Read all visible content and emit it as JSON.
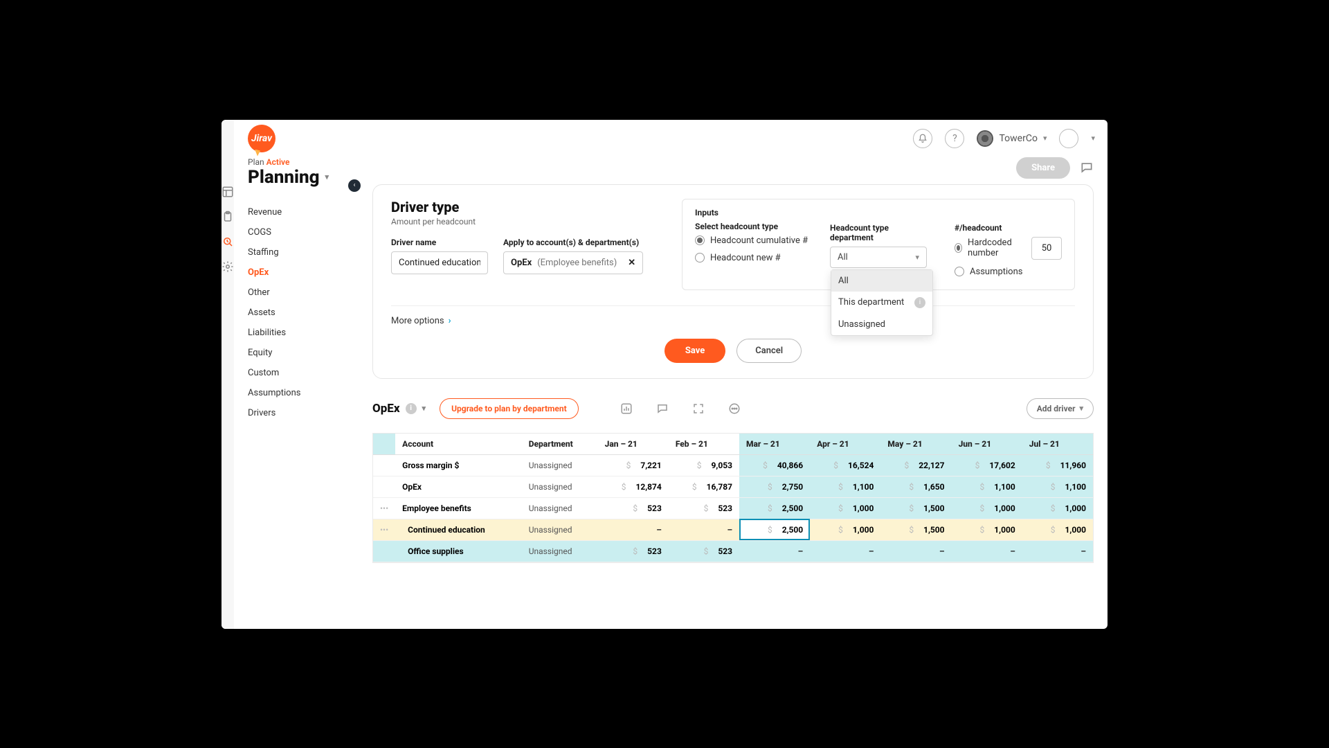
{
  "brand": {
    "name": "Jirav"
  },
  "top": {
    "org": "TowerCo",
    "share": "Share"
  },
  "plan": {
    "label": "Plan",
    "status": "Active",
    "title": "Planning"
  },
  "nav": [
    "Revenue",
    "COGS",
    "Staffing",
    "OpEx",
    "Other",
    "Assets",
    "Liabilities",
    "Equity",
    "Custom",
    "Assumptions",
    "Drivers"
  ],
  "nav_active": "OpEx",
  "driver": {
    "section_title": "Driver type",
    "section_sub": "Amount per headcount",
    "name_label": "Driver name",
    "name_value": "Continued education",
    "apply_label": "Apply to account(s) & department(s)",
    "apply_account": "OpEx",
    "apply_detail": "(Employee benefits)",
    "more_options": "More options",
    "save": "Save",
    "cancel": "Cancel"
  },
  "inputs": {
    "title": "Inputs",
    "headcount_type_label": "Select headcount type",
    "headcount_options": [
      "Headcount cumulative #",
      "Headcount new #"
    ],
    "headcount_selected": 0,
    "dept_label": "Headcount type department",
    "dept_value": "All",
    "dept_options": [
      "All",
      "This department",
      "Unassigned"
    ],
    "per_label": "#/headcount",
    "per_options": [
      "Hardcoded number",
      "Assumptions"
    ],
    "per_selected": 0,
    "per_value": "50"
  },
  "table_toolbar": {
    "title": "OpEx",
    "upgrade": "Upgrade to plan by department",
    "add_driver": "Add driver"
  },
  "table": {
    "columns": [
      "Account",
      "Department",
      "Jan – 21",
      "Feb – 21",
      "Mar – 21",
      "Apr – 21",
      "May – 21",
      "Jun – 21",
      "Jul – 21"
    ],
    "highlight_from_col": 4,
    "rows": [
      {
        "kind": "plain",
        "indent": 0,
        "account": "Gross margin $",
        "dept": "Unassigned",
        "values": [
          "7,221",
          "9,053",
          "40,866",
          "16,524",
          "22,127",
          "17,602",
          "11,960"
        ]
      },
      {
        "kind": "plain",
        "indent": 0,
        "account": "OpEx",
        "dept": "Unassigned",
        "values": [
          "12,874",
          "16,787",
          "2,750",
          "1,100",
          "1,650",
          "1,100",
          "1,100"
        ]
      },
      {
        "kind": "handle",
        "indent": 0,
        "account": "Employee benefits",
        "dept": "Unassigned",
        "values": [
          "523",
          "523",
          "2,500",
          "1,000",
          "1,500",
          "1,000",
          "1,000"
        ]
      },
      {
        "kind": "handle yellow active",
        "indent": 1,
        "account": "Continued education",
        "dept": "Unassigned",
        "values": [
          "–",
          "–",
          "2,500",
          "1,000",
          "1,500",
          "1,000",
          "1,000"
        ]
      },
      {
        "kind": "blue",
        "indent": 1,
        "account": "Office supplies",
        "dept": "Unassigned",
        "values": [
          "523",
          "523",
          "–",
          "–",
          "–",
          "–",
          "–"
        ]
      }
    ]
  }
}
